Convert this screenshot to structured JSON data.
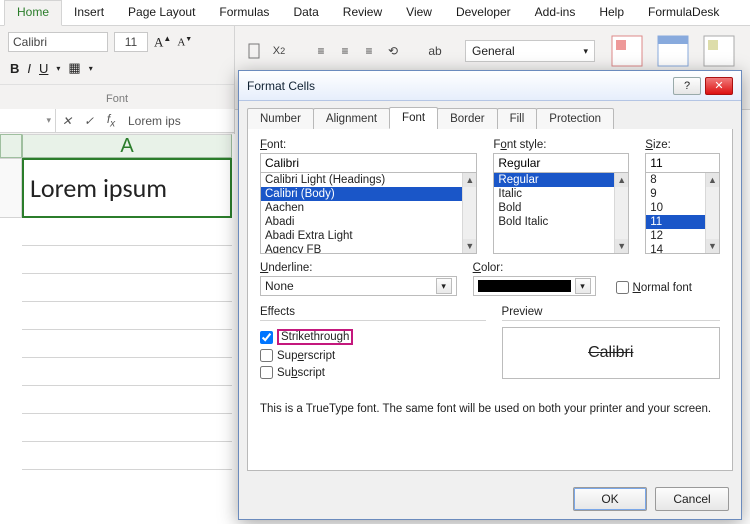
{
  "ribbon": {
    "tabs": [
      "Home",
      "Insert",
      "Page Layout",
      "Formulas",
      "Data",
      "Review",
      "View",
      "Developer",
      "Add-ins",
      "Help",
      "FormulaDesk"
    ],
    "active_tab": "Home",
    "font_name": "Calibri",
    "font_size": "11",
    "section_label": "Font",
    "number_format": "General"
  },
  "formula_bar": {
    "name_box": "",
    "cell_content": "Lorem ips"
  },
  "sheet": {
    "col_header": "A",
    "a1_value": "Lorem ipsum"
  },
  "dialog": {
    "title": "Format Cells",
    "tabs": [
      "Number",
      "Alignment",
      "Font",
      "Border",
      "Fill",
      "Protection"
    ],
    "active_tab": "Font",
    "font_label": "Font:",
    "font_value": "Calibri",
    "font_list": [
      "Calibri Light (Headings)",
      "Calibri (Body)",
      "Aachen",
      "Abadi",
      "Abadi Extra Light",
      "Agency FB"
    ],
    "font_selected_index": 1,
    "style_label": "Font style:",
    "style_value": "Regular",
    "style_list": [
      "Regular",
      "Italic",
      "Bold",
      "Bold Italic"
    ],
    "style_selected_index": 0,
    "size_label": "Size:",
    "size_value": "11",
    "size_list": [
      "8",
      "9",
      "10",
      "11",
      "12",
      "14"
    ],
    "size_selected_index": 3,
    "underline_label": "Underline:",
    "underline_value": "None",
    "color_label": "Color:",
    "normal_font_label": "Normal font",
    "normal_font_checked": false,
    "effects_label": "Effects",
    "strike_label": "Strikethrough",
    "strike_checked": true,
    "super_label": "Superscript",
    "super_checked": false,
    "sub_label": "Subscript",
    "sub_checked": false,
    "preview_label": "Preview",
    "preview_text": "Calibri",
    "info_text": "This is a TrueType font.  The same font will be used on both your printer and your screen.",
    "ok_label": "OK",
    "cancel_label": "Cancel"
  }
}
